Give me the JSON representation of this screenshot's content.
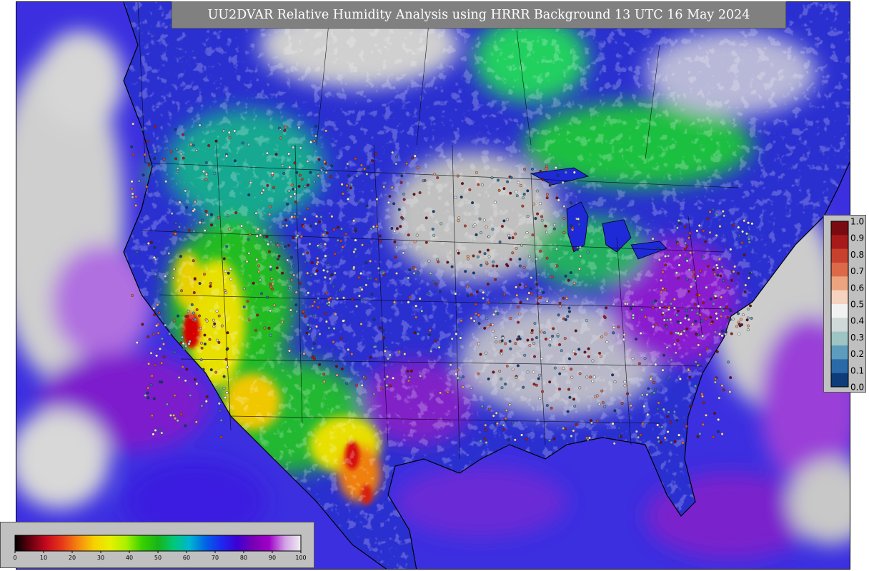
{
  "title": "UU2DVAR Relative Humidity Analysis using HRRR Background 13 UTC 16 May 2024",
  "colors": {
    "ocean": "#3b2fe0",
    "land_moist": "#2a2fd0",
    "dry_green": "#22bb22",
    "dry_yellow": "#e8e000",
    "dry_red": "#d40000",
    "saturated": "#c8c8c8",
    "purple": "#8a1ccf",
    "teal": "#0aa0c8"
  },
  "rh_colorbar": {
    "ticks": [
      "0",
      "10",
      "20",
      "30",
      "40",
      "50",
      "60",
      "70",
      "80",
      "90",
      "100"
    ],
    "stops": [
      "#000000",
      "#6a0010",
      "#c80a1e",
      "#e83a1a",
      "#f58a10",
      "#f7d200",
      "#e6f000",
      "#aaf000",
      "#38d200",
      "#18b418",
      "#00c878",
      "#00b4d2",
      "#0064e6",
      "#1e28f0",
      "#3c00d2",
      "#7800b4",
      "#a000c8",
      "#d2a0e6",
      "#f0f0f0"
    ]
  },
  "obs_legend": {
    "ticks": [
      "1.0",
      "0.9",
      "0.8",
      "0.7",
      "0.6",
      "0.5",
      "0.4",
      "0.3",
      "0.2",
      "0.1",
      "0.0"
    ],
    "colors": [
      "#7a0a12",
      "#a81a1a",
      "#c8402e",
      "#dc6a48",
      "#eba47e",
      "#f6d2c0",
      "#f2f2f2",
      "#d0d8d8",
      "#9ec4c4",
      "#5e9cbe",
      "#2a6aa8",
      "#0e3c7a"
    ]
  }
}
